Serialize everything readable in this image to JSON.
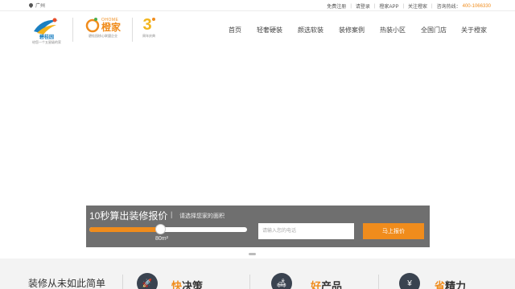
{
  "topbar": {
    "city": "广州",
    "links": [
      "免费注册",
      "请登录",
      "橙家APP",
      "关注橙家"
    ],
    "hotline_label": "咨询热线：",
    "hotline_number": "400-1066330"
  },
  "logos": {
    "brand1_name": "碧桂园",
    "brand1_tagline": "给您一个五星级的家",
    "brand2_prefix": "OHOME",
    "brand2_name": "橙家",
    "brand2_tagline": "碧桂园核心联盟企业",
    "brand3_mark": "3",
    "brand3_tagline": "周年庆典"
  },
  "nav": [
    "首页",
    "轻奢硬装",
    "颜选软装",
    "装修案例",
    "热装小区",
    "全国门店",
    "关于橙家"
  ],
  "quote": {
    "title": "10秒算出装修报价",
    "divider": "|",
    "subtitle": "请选择您家的面积",
    "area_value": "80m²",
    "slider_fraction": 0.45,
    "phone_placeholder": "请输入您的电话",
    "submit_label": "马上报价"
  },
  "features": {
    "slogan": "装修从未如此简单",
    "items": [
      {
        "icon": "rocket-icon",
        "glyph": "🚀",
        "highlight": "快",
        "rest": "决策"
      },
      {
        "icon": "sofa-icon",
        "glyph": "🛋",
        "highlight": "好",
        "rest": "产品"
      },
      {
        "icon": "yen-icon",
        "glyph": "¥",
        "highlight": "省",
        "rest": "精力"
      }
    ]
  },
  "colors": {
    "accent": "#f08c1c",
    "panel": "#6f6f6f",
    "dark_icon": "#3a4350"
  }
}
